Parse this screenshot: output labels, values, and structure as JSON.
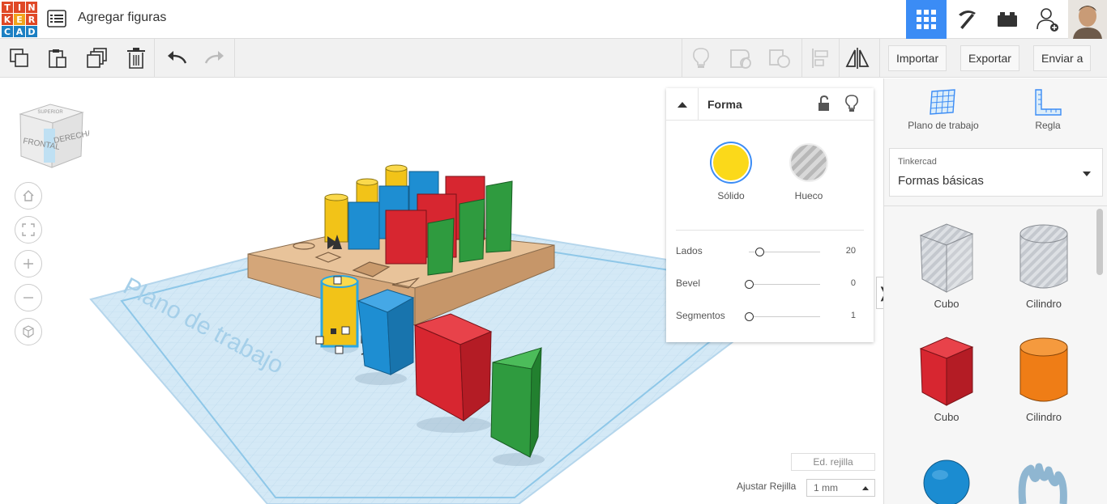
{
  "header": {
    "logo_letters": [
      "T",
      "I",
      "N",
      "K",
      "E",
      "R",
      "C",
      "A",
      "D"
    ],
    "logo_colors": [
      "#e04826",
      "#e04826",
      "#e04826",
      "#e04826",
      "#f2a41c",
      "#e04826",
      "#1d80c3",
      "#1d80c3",
      "#1d80c3"
    ],
    "design_title": "Agregar figuras",
    "icons": [
      "grid-view-icon",
      "pickaxe-icon",
      "brick-icon",
      "add-user-icon",
      "user-avatar"
    ],
    "accent": "#3b8cf5"
  },
  "toolbar": {
    "left_icons": [
      "copy-icon",
      "paste-icon",
      "duplicate-icon",
      "delete-icon",
      "undo-icon",
      "redo-icon"
    ],
    "right_icons": [
      "light-bulb-icon",
      "group-icon",
      "ungroup-icon",
      "align-icon",
      "mirror-icon"
    ],
    "import_label": "Importar",
    "export_label": "Exportar",
    "send_label": "Enviar a"
  },
  "viewcube": {
    "top": "SUPERIOR",
    "front": "FRONTAL",
    "right": "DERECHA"
  },
  "workplane": {
    "label": "Plano de trabajo"
  },
  "inspector": {
    "title": "Forma",
    "solid_label": "Sólido",
    "hole_label": "Hueco",
    "solid_color": "#fbd91a",
    "properties": [
      {
        "label": "Lados",
        "value": "20",
        "fraction": 0.15
      },
      {
        "label": "Bevel",
        "value": "0",
        "fraction": 0.0
      },
      {
        "label": "Segmentos",
        "value": "1",
        "fraction": 0.0
      }
    ]
  },
  "grid": {
    "edit_label": "Ed. rejilla",
    "snap_label": "Ajustar Rejilla",
    "snap_value": "1 mm"
  },
  "right_panel": {
    "workplane_label": "Plano de trabajo",
    "ruler_label": "Regla",
    "library_category": "Tinkercad",
    "library_name": "Formas básicas",
    "shapes": [
      {
        "label": "Cubo",
        "color": "#b8bcc4",
        "style": "hole"
      },
      {
        "label": "Cilindro",
        "color": "#b8bcc4",
        "style": "hole"
      },
      {
        "label": "Cubo",
        "color": "#d9222e",
        "style": "solid"
      },
      {
        "label": "Cilindro",
        "color": "#ef7d16",
        "style": "solid"
      },
      {
        "label": "",
        "color": "#1b8cd1",
        "style": "sphere"
      },
      {
        "label": "",
        "color": "#8fb6d1",
        "style": "scribble"
      }
    ]
  }
}
